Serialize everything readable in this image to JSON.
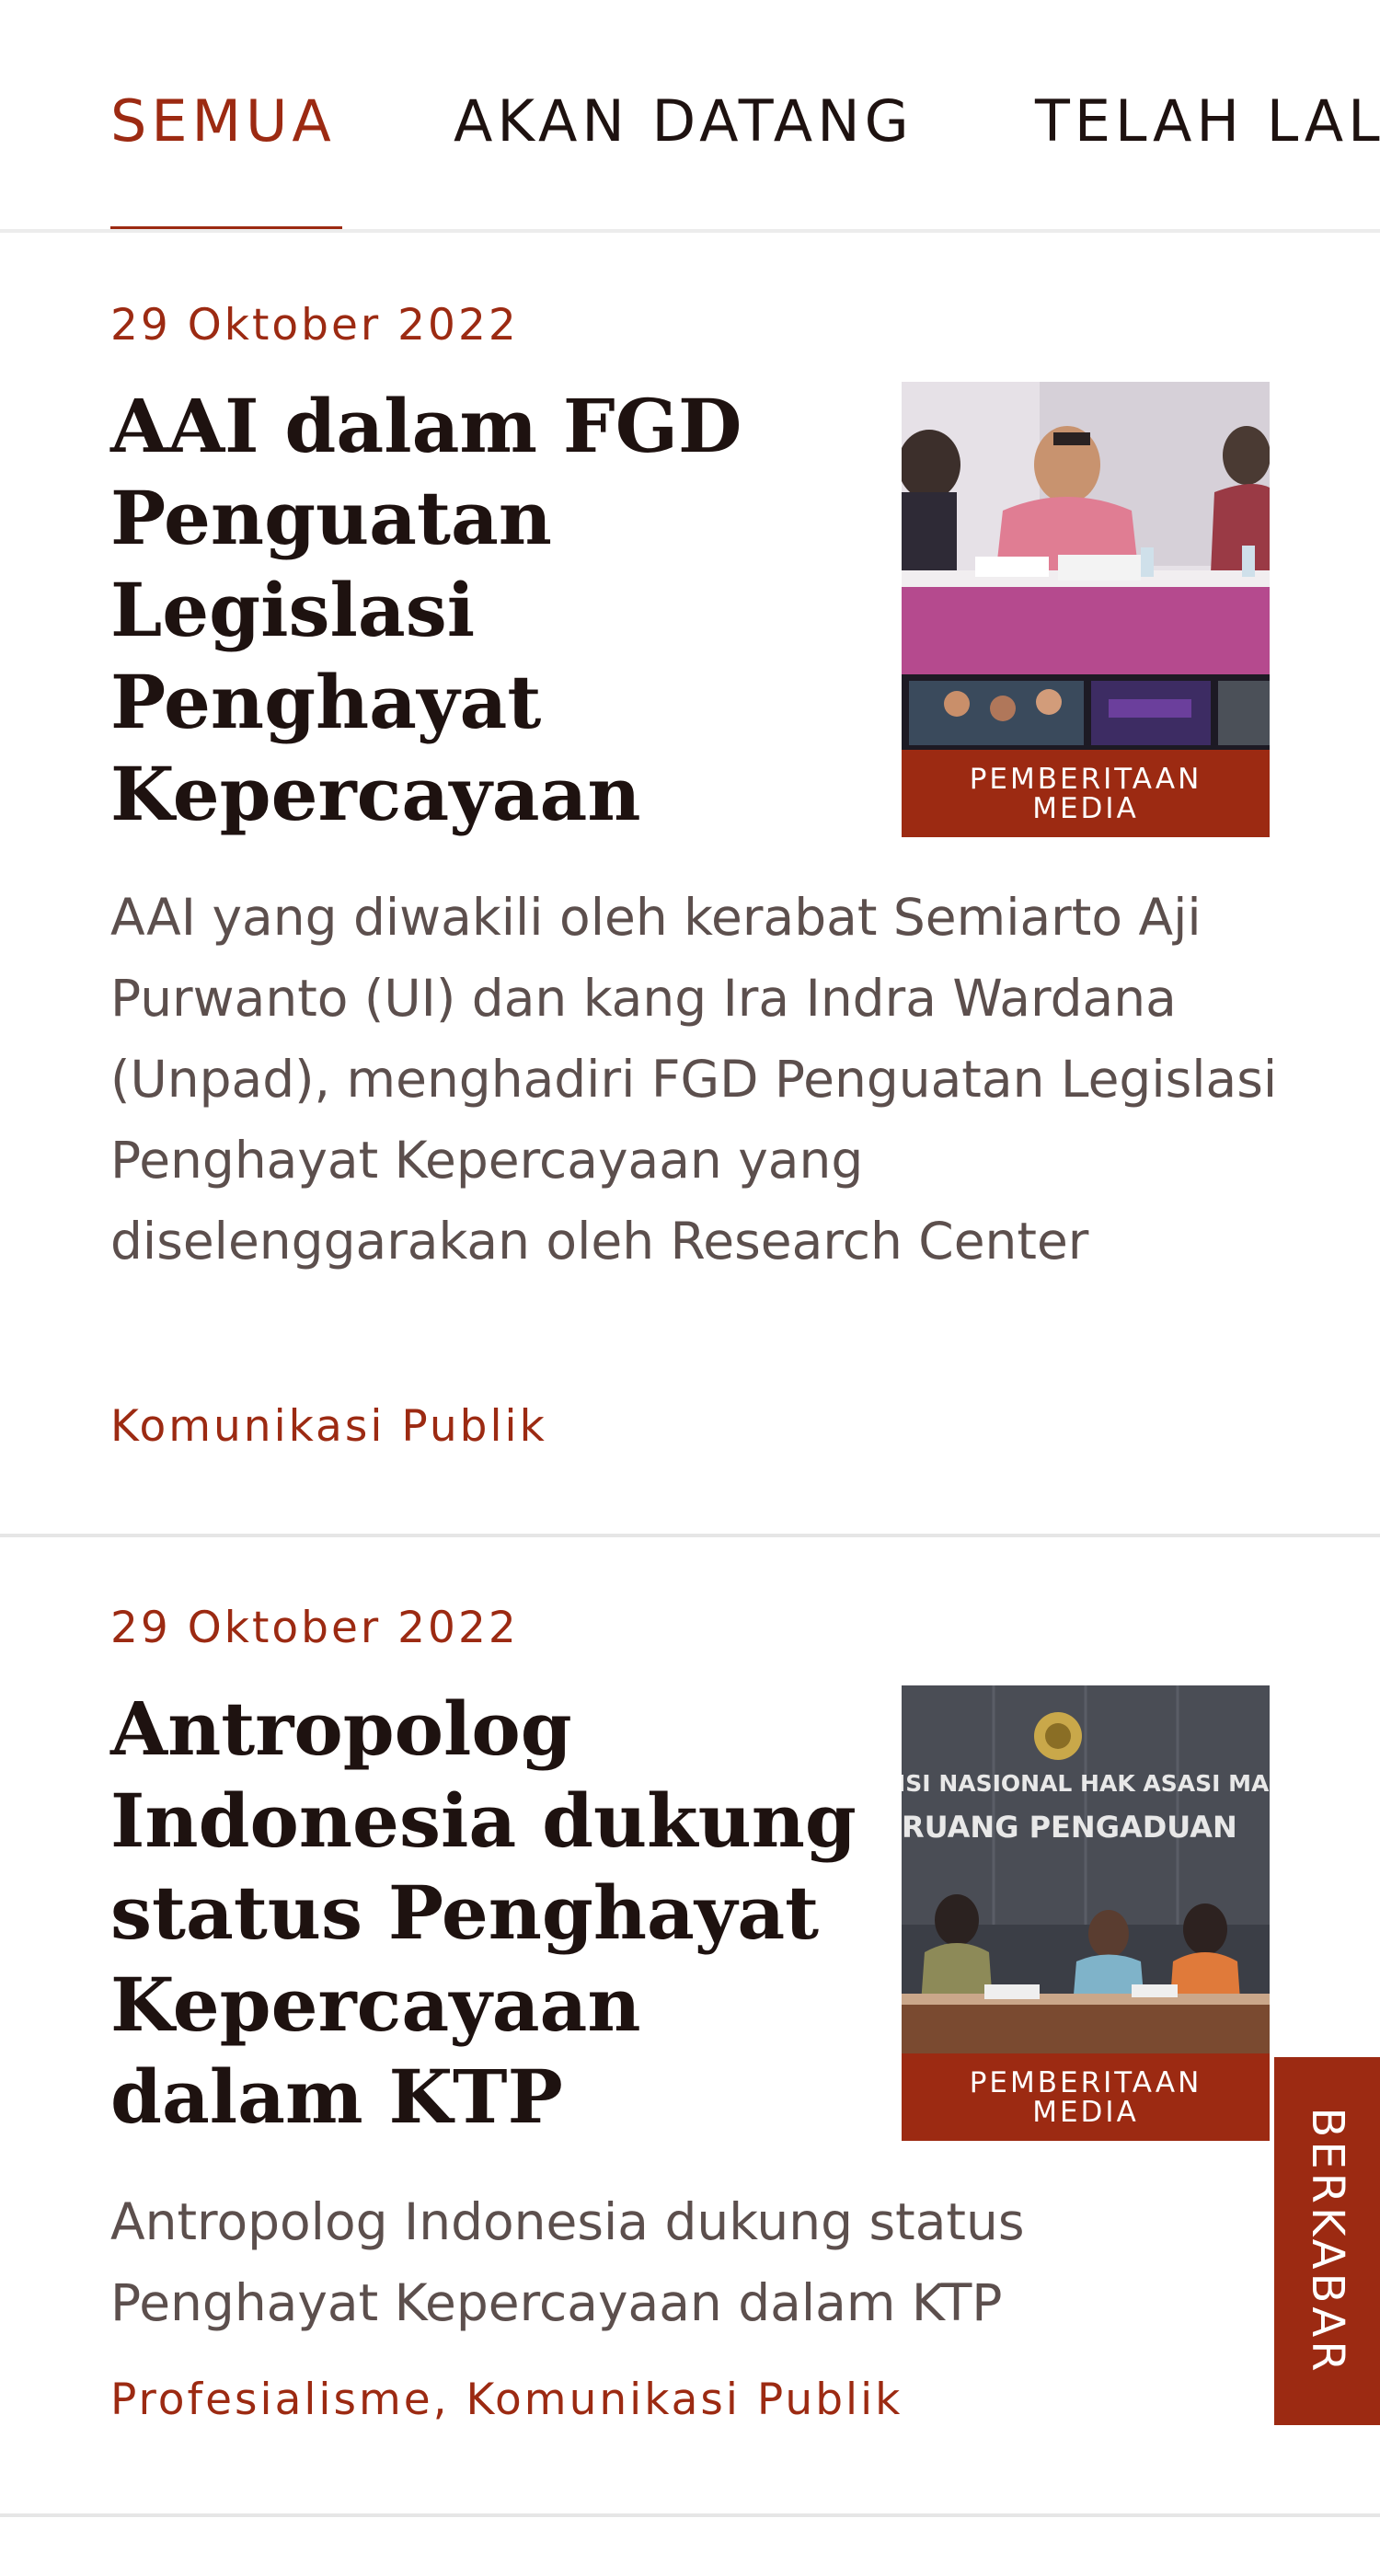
{
  "tabs": [
    {
      "label": "SEMUA",
      "active": true
    },
    {
      "label": "AKAN DATANG",
      "active": false
    },
    {
      "label": "TELAH LALU",
      "active": false
    }
  ],
  "articles": [
    {
      "date": "29 Oktober 2022",
      "title": "AAI dalam FGD Penguatan Legislasi Penghayat Kepercayaan",
      "badge": "PEMBERITAAN MEDIA",
      "excerpt": "AAI yang diwakili oleh kerabat Semiarto Aji Purwanto (UI) dan kang Ira Indra Wardana (Unpad), menghadiri FGD Penguatan Legislasi Penghayat Kepercayaan yang diselenggarakan oleh Research Center",
      "categories": "Komunikasi Publik",
      "photo_description": "panel discussion photo"
    },
    {
      "date": "29 Oktober 2022",
      "title": "Antropolog Indonesia dukung status Penghayat Kepercayaan dalam KTP",
      "badge": "PEMBERITAAN MEDIA",
      "excerpt": "Antropolog Indonesia dukung status Penghayat Kepercayaan dalam KTP",
      "categories": "Profesialisme, Komunikasi Publik",
      "photo_text_line1": "ISI NASIONAL HAK ASASI MANUS",
      "photo_text_line2": "RUANG PENGADUAN"
    }
  ],
  "side_tab": {
    "label": "BERKABAR"
  },
  "colors": {
    "accent": "#9c2a12",
    "title": "#1e1210",
    "body_text": "#5c4f4d",
    "divider": "#e6e6e6"
  }
}
